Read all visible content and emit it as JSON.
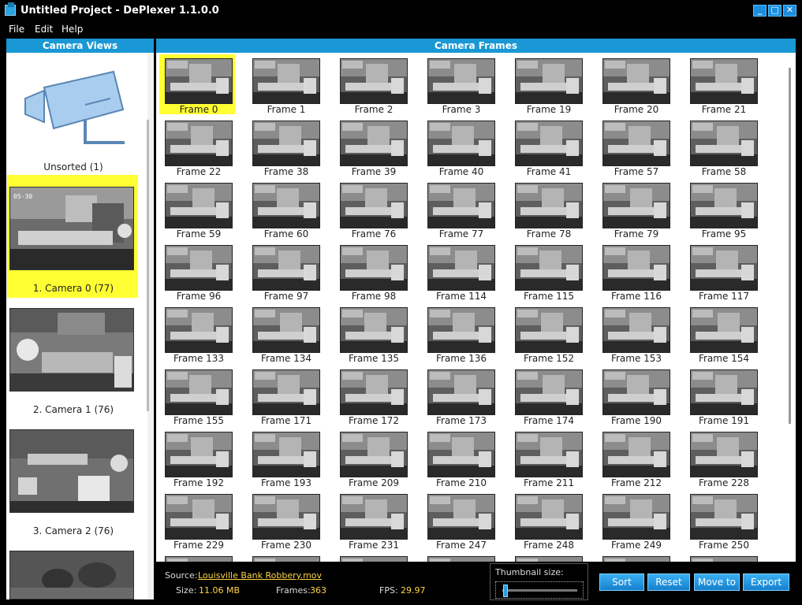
{
  "window": {
    "title": "Untitled Project - DePlexer 1.1.0.0",
    "controls": {
      "minimize": "_",
      "maximize": "□",
      "close": "✕"
    }
  },
  "menu": [
    "File",
    "Edit",
    "Help"
  ],
  "camera_views": {
    "header": "Camera Views",
    "items": [
      {
        "label": "Unsorted (1)",
        "icon": "security-camera-icon"
      },
      {
        "label": "1. Camera 0 (77)",
        "selected": true
      },
      {
        "label": "2. Camera 1 (76)"
      },
      {
        "label": "3. Camera 2 (76)"
      },
      {
        "label": ""
      }
    ]
  },
  "camera_frames": {
    "header": "Camera Frames",
    "frames": [
      "Frame 0",
      "Frame 1",
      "Frame 2",
      "Frame 3",
      "Frame 19",
      "Frame 20",
      "Frame 21",
      "Frame 22",
      "Frame 38",
      "Frame 39",
      "Frame 40",
      "Frame 41",
      "Frame 57",
      "Frame 58",
      "Frame 59",
      "Frame 60",
      "Frame 76",
      "Frame 77",
      "Frame 78",
      "Frame 79",
      "Frame 95",
      "Frame 96",
      "Frame 97",
      "Frame 98",
      "Frame 114",
      "Frame 115",
      "Frame 116",
      "Frame 117",
      "Frame 133",
      "Frame 134",
      "Frame 135",
      "Frame 136",
      "Frame 152",
      "Frame 153",
      "Frame 154",
      "Frame 155",
      "Frame 171",
      "Frame 172",
      "Frame 173",
      "Frame 174",
      "Frame 190",
      "Frame 191",
      "Frame 192",
      "Frame 193",
      "Frame 209",
      "Frame 210",
      "Frame 211",
      "Frame 212",
      "Frame 228",
      "Frame 229",
      "Frame 230",
      "Frame 231",
      "Frame 247",
      "Frame 248",
      "Frame 249",
      "Frame 250"
    ],
    "selected": "Frame 0"
  },
  "status": {
    "source_label": "Source:",
    "source_value": "Louisville Bank Robbery.mov",
    "size_label": "Size:",
    "size_value": "11.06 MB",
    "frames_label": "Frames:",
    "frames_value": "363",
    "fps_label": "FPS:",
    "fps_value": "29.97"
  },
  "thumbnail_size": {
    "label": "Thumbnail size:",
    "value_fraction": 0.02
  },
  "buttons": {
    "sort": "Sort",
    "reset": "Reset",
    "move_to": "Move to",
    "export": "Export"
  },
  "colors": {
    "accent": "#1a98d5",
    "selection": "#ffff33",
    "status_value": "#ffd54a"
  }
}
